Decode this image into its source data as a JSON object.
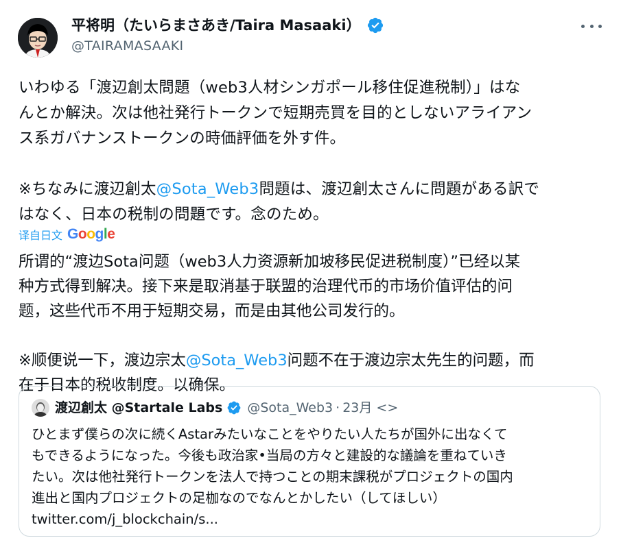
{
  "author": {
    "name": "平将明（たいらまさあき/Taira Masaaki）",
    "handle": "@TAIRAMASAAKI"
  },
  "tweet": {
    "line1": "いわゆる「渡辺創太問題（web3人材シンガポール移住促進税制）」はな",
    "line2": "んとか解決。次は他社発行トークンで短期売買を目的としないアライアン",
    "line3": "ス系ガバナンストークンの時価評価を外す件。",
    "p2_line1_pre": "※ちなみに渡辺創太",
    "mention": "@Sota_Web3",
    "p2_line1_post": "問題は、渡辺創太さんに問題がある訳で",
    "p2_line2": "はなく、日本の税制の問題です。念のため。"
  },
  "translation": {
    "label": "译自日文",
    "provider": "Google",
    "line1": "所谓的“渡边Sota问题（web3人力资源新加坡移民促进税制度）”已经以某",
    "line2": "种方式得到解决。接下来是取消基于联盟的治理代币的市场价值评估的问",
    "line3": "题，这些代币不用于短期交易，而是由其他公司发行的。",
    "p2_line1_pre": "※顺便说一下，渡边宗太",
    "mention": "@Sota_Web3",
    "p2_line1_post": "问题不在于渡边宗太先生的问题，而",
    "p2_line2": "在于日本的税收制度。以确保。"
  },
  "quote": {
    "name": "渡辺創太 @Startale Labs",
    "handle": "@Sota_Web3",
    "separator": "·",
    "time": "23月 <>",
    "line1": "ひとまず僕らの次に続くAstarみたいなことをやりたい人たちが国外に出なくて",
    "line2": "もできるようになった。今後も政治家•当局の方々と建設的な議論を重ねていき",
    "line3": "たい。次は他社発行トークンを法人で持つことの期末課税がプロジェクトの国内",
    "line4": "進出と国内プロジェクトの足枷なのでなんとかしたい（してほしい）",
    "link": "twitter.com/j_blockchain/s..."
  },
  "colors": {
    "accent": "#1d9bf0",
    "secondary_text": "#536471",
    "border": "#cfd9de"
  },
  "icons": [
    "avatar",
    "verified-badge-icon",
    "more-options-icon"
  ]
}
